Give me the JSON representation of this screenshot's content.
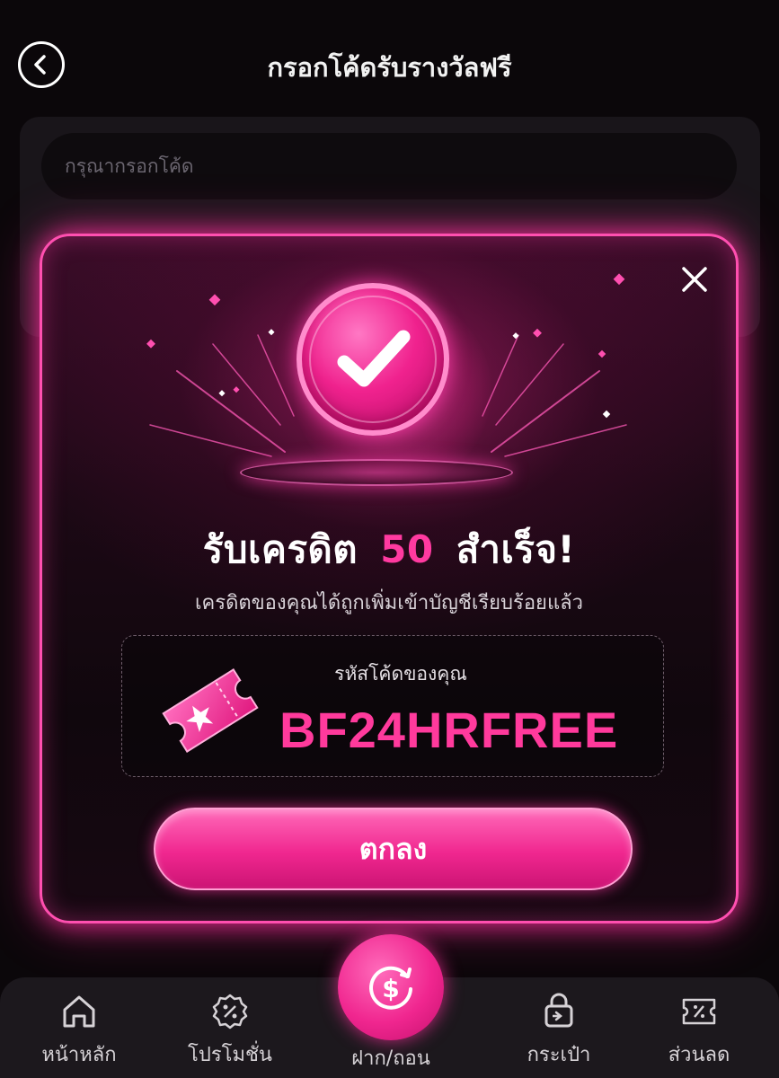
{
  "header": {
    "title": "กรอกโค้ดรับรางวัลฟรี",
    "back_icon": "chevron-left-icon"
  },
  "form": {
    "code_placeholder": "กรุณากรอกโค้ด",
    "code_value": ""
  },
  "modal": {
    "close_icon": "close-icon",
    "status_icon": "check-circle-icon",
    "headline_prefix": "รับเครดิต",
    "headline_amount": "50",
    "headline_suffix": "สำเร็จ!",
    "subtext": "เครดิตของคุณได้ถูกเพิ่มเข้าบัญชีเรียบร้อยแล้ว",
    "code_label": "รหัสโค้ดของคุณ",
    "code_value": "BF24HRFREE",
    "ticket_icon": "ticket-icon",
    "ok_label": "ตกลง"
  },
  "bottom_nav": {
    "items": [
      {
        "label": "หน้าหลัก",
        "icon": "home-icon"
      },
      {
        "label": "โปรโมชั่น",
        "icon": "promotion-badge-icon"
      },
      {
        "label": "ฝาก/ถอน",
        "icon": "dollar-exchange-icon"
      },
      {
        "label": "กระเป๋า",
        "icon": "wallet-icon"
      },
      {
        "label": "ส่วนลด",
        "icon": "discount-coupon-icon"
      }
    ]
  },
  "colors": {
    "accent": "#ff3aa0",
    "background": "#0b070a",
    "modal_border": "#ff4fb0"
  }
}
